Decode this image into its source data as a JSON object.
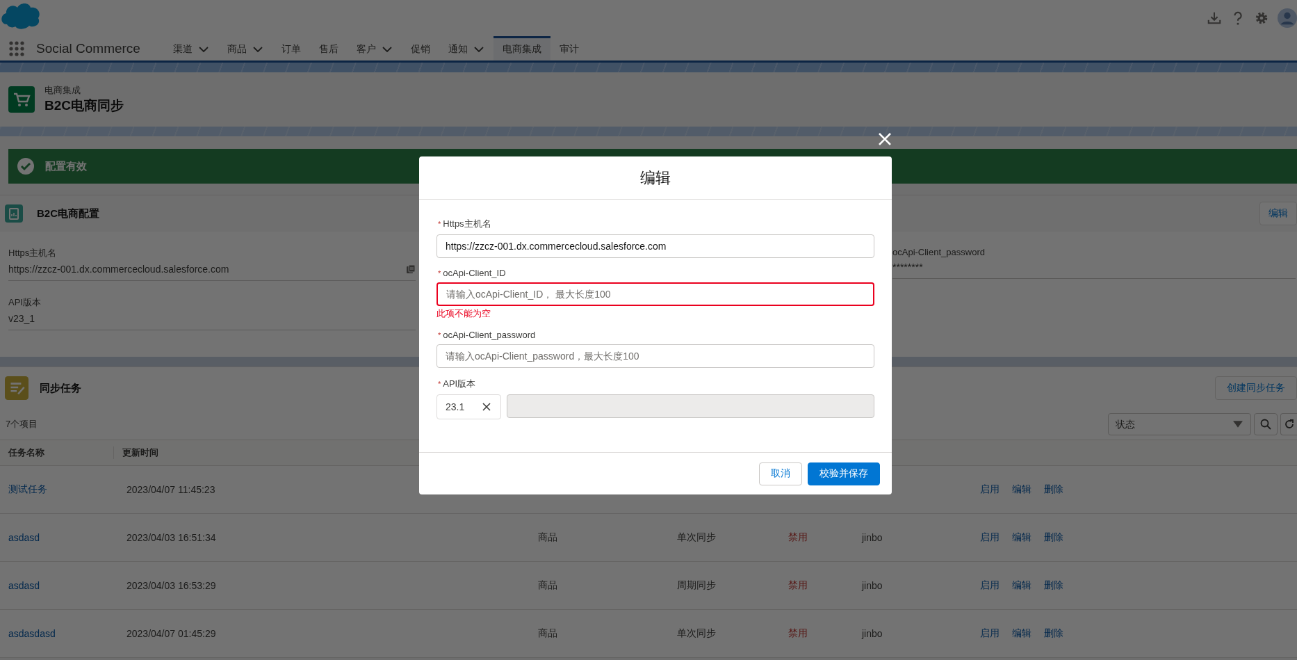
{
  "app": {
    "name": "Social Commerce"
  },
  "nav": [
    {
      "label": "渠道",
      "dropdown": true,
      "selected": false
    },
    {
      "label": "商品",
      "dropdown": true,
      "selected": false
    },
    {
      "label": "订单",
      "dropdown": false,
      "selected": false
    },
    {
      "label": "售后",
      "dropdown": false,
      "selected": false
    },
    {
      "label": "客户",
      "dropdown": true,
      "selected": false
    },
    {
      "label": "促销",
      "dropdown": false,
      "selected": false
    },
    {
      "label": "通知",
      "dropdown": true,
      "selected": false
    },
    {
      "label": "电商集成",
      "dropdown": false,
      "selected": true
    },
    {
      "label": "审计",
      "dropdown": false,
      "selected": false
    }
  ],
  "page_header": {
    "breadcrumb": "电商集成",
    "title": "B2C电商同步"
  },
  "toast": {
    "message": "配置有效"
  },
  "config_card": {
    "title": "B2C电商配置",
    "edit_button": "编辑",
    "left_fields": [
      {
        "label": "Https主机名",
        "value": "https://zzcz-001.dx.commercecloud.salesforce.com",
        "copyable": true
      },
      {
        "label": "API版本",
        "value": "v23_1",
        "copyable": false
      }
    ],
    "right_fields": [
      {
        "label": "ocApi-Client_password",
        "value": "********",
        "copyable": false
      }
    ]
  },
  "tasks_card": {
    "title": "同步任务",
    "create_button": "创建同步任务",
    "count": "7个项目",
    "filter": {
      "placeholder": "状态"
    },
    "columns": [
      "任务名称",
      "更新时间"
    ],
    "rows": [
      {
        "name": "测试任务",
        "updated": "2023/04/07 11:45:23",
        "actions": [
          "启用",
          "编辑",
          "删除"
        ]
      },
      {
        "name": "asdasd",
        "updated": "2023/04/03 16:51:34",
        "type": "商品",
        "mode": "单次同步",
        "status": "禁用",
        "owner": "jinbo",
        "actions": [
          "启用",
          "编辑",
          "删除"
        ]
      },
      {
        "name": "asdasd",
        "updated": "2023/04/03 16:53:29",
        "type": "商品",
        "mode": "周期同步",
        "status": "禁用",
        "owner": "jinbo",
        "actions": [
          "启用",
          "编辑",
          "删除"
        ]
      },
      {
        "name": "asdasdasd",
        "updated": "2023/04/07 01:45:29",
        "type": "商品",
        "mode": "单次同步",
        "status": "禁用",
        "owner": "jinbo",
        "actions": [
          "启用",
          "编辑",
          "删除"
        ]
      }
    ]
  },
  "modal": {
    "title": "编辑",
    "fields": [
      {
        "kind": "text",
        "required_mark": "*",
        "label": "Https主机名",
        "value": "https://zzcz-001.dx.commercecloud.salesforce.com",
        "invalid": false
      },
      {
        "kind": "text",
        "required_mark": "*",
        "label": "ocApi-Client_ID",
        "placeholder": "请输入ocApi-Client_ID， 最大长度100",
        "invalid": true,
        "error": "此项不能为空"
      },
      {
        "kind": "text",
        "required_mark": "*",
        "label": "ocApi-Client_password",
        "placeholder": "请输入ocApi-Client_password，最大长度100",
        "invalid": false
      },
      {
        "kind": "version",
        "required_mark": "*",
        "label": "API版本",
        "value": "23.1",
        "invalid": false
      }
    ],
    "buttons": [
      {
        "label": "取消",
        "primary": false
      },
      {
        "label": "校验并保存",
        "primary": true
      }
    ]
  }
}
